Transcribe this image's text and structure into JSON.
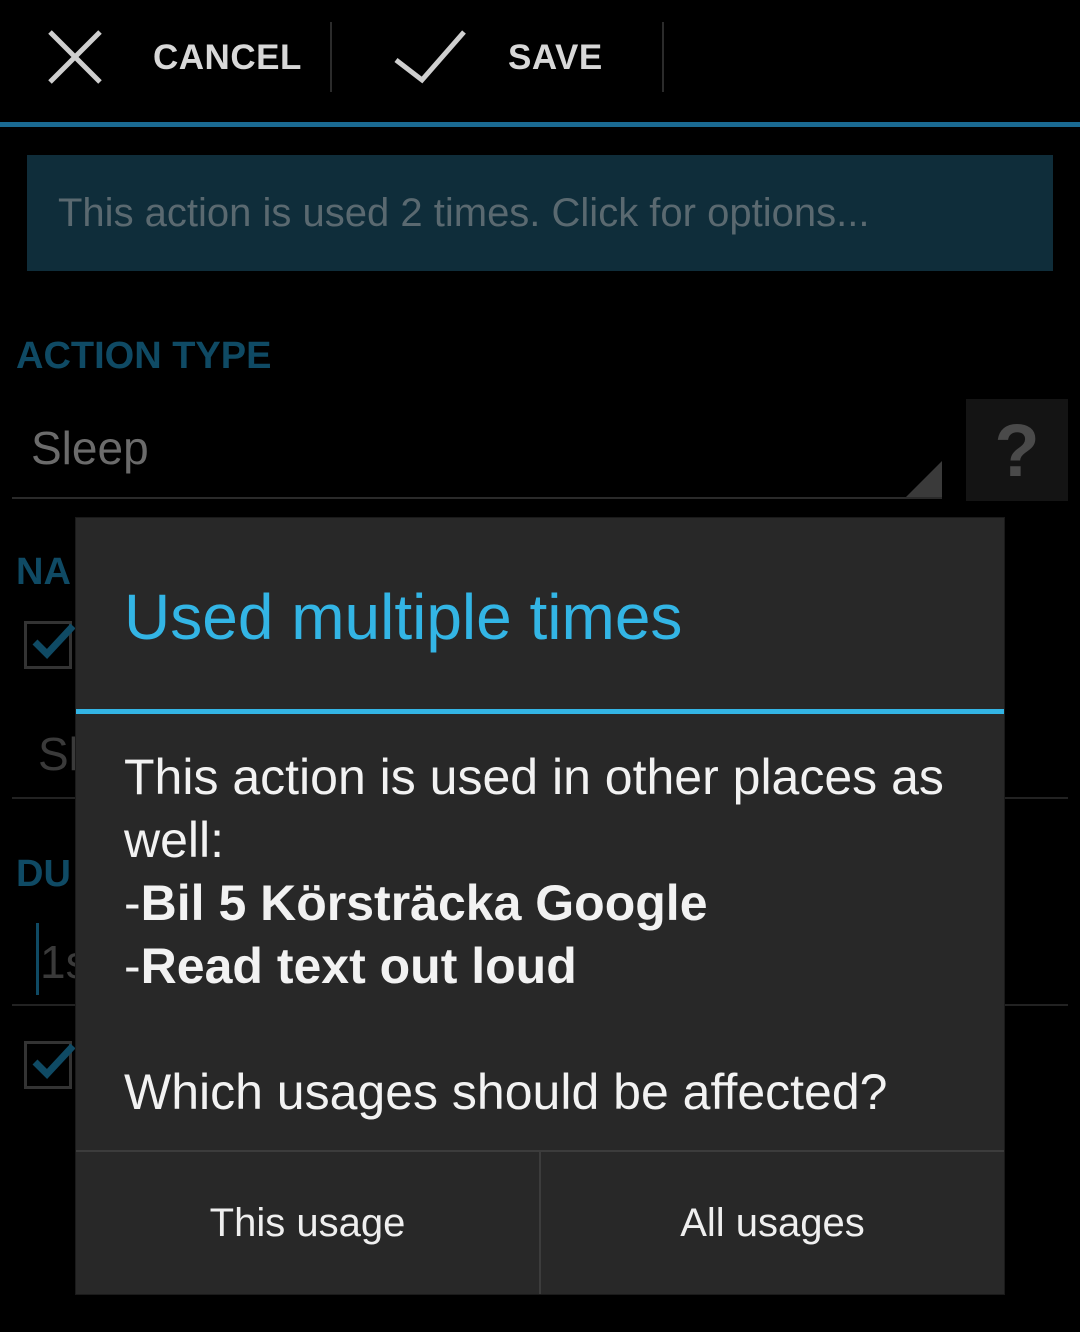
{
  "actionbar": {
    "cancel_label": "CANCEL",
    "save_label": "SAVE",
    "accent_color": "#1a6a92"
  },
  "background": {
    "info_banner": "This action is used 2 times. Click for options...",
    "action_type_header": "ACTION TYPE",
    "action_type_value": "Sleep",
    "help_label": "?",
    "name_header_partial": "NA",
    "name_field_partial": "Sl",
    "duration_header_partial": "DU",
    "duration_field_partial": "1s"
  },
  "dialog": {
    "title": "Used multiple times",
    "message_intro": "This action is used in other places as well:",
    "usages": [
      {
        "prefix": "-",
        "name": "Bil 5 Körsträcka Google"
      },
      {
        "prefix": "-",
        "name": "Read text out loud"
      }
    ],
    "question": "Which usages should be affected?",
    "buttons": {
      "this_usage": "This usage",
      "all_usages": "All usages"
    },
    "accent_color": "#33b5e5"
  }
}
